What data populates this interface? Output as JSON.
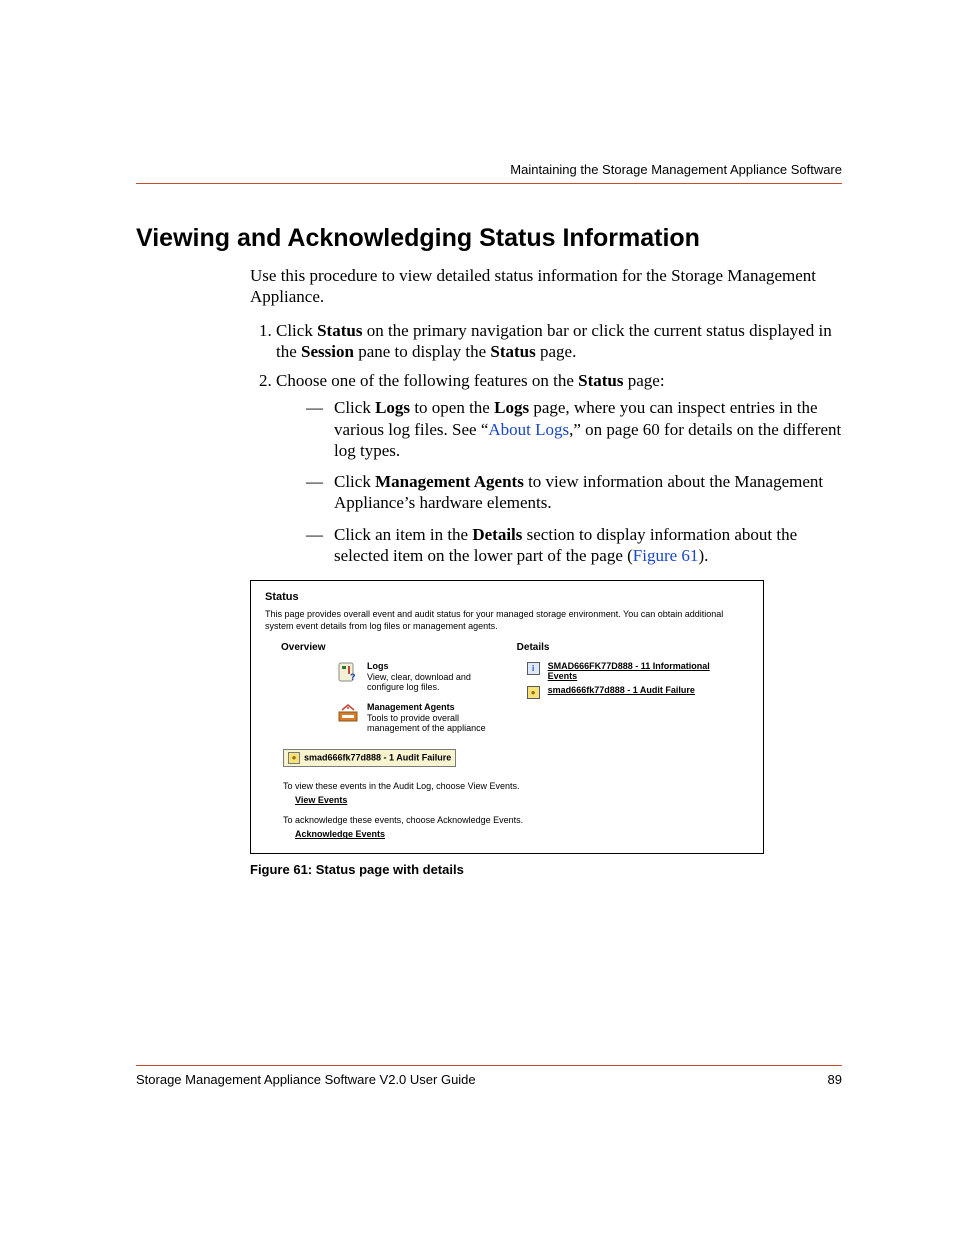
{
  "header": {
    "running_title": "Maintaining the Storage Management Appliance Software"
  },
  "title": "Viewing and Acknowledging Status Information",
  "intro": "Use this procedure to view detailed status information for the Storage Management Appliance.",
  "steps": {
    "s1_a": "Click ",
    "s1_b": "Status",
    "s1_c": " on the primary navigation bar or click the current status displayed in the ",
    "s1_d": "Session",
    "s1_e": " pane to display the ",
    "s1_f": "Status",
    "s1_g": " page.",
    "s2_a": "Choose one of the following features on the ",
    "s2_b": "Status",
    "s2_c": " page:",
    "b1_a": "Click ",
    "b1_b": "Logs",
    "b1_c": " to open the ",
    "b1_d": "Logs",
    "b1_e": " page, where you can inspect entries in the various log files. See “",
    "b1_link": "About Logs",
    "b1_f": ",” on page 60 for details on the different log types.",
    "b2_a": "Click ",
    "b2_b": "Management Agents",
    "b2_c": " to view information about the Management Appliance’s hardware elements.",
    "b3_a": "Click an item in the ",
    "b3_b": "Details",
    "b3_c": " section to display information about the selected item on the lower part of the page (",
    "b3_link": "Figure 61",
    "b3_d": ")."
  },
  "figure": {
    "title": "Status",
    "description": "This page provides overall event and audit status for your managed storage environment. You can obtain additional system event details from log files or management agents.",
    "overview_label": "Overview",
    "details_label": "Details",
    "logs_label": "Logs",
    "logs_desc": "View, clear, download and configure log files.",
    "agents_label": "Management Agents",
    "agents_desc": "Tools to provide overall management of the appliance",
    "detail1": "SMAD666FK77D888 - 11 Informational Events",
    "detail2": "smad666fk77d888 - 1 Audit Failure",
    "selected": "smad666fk77d888 - 1 Audit Failure",
    "view_line": "To view these events in the Audit Log, choose View Events.",
    "view_link": "View Events",
    "ack_line": "To acknowledge these events, choose Acknowledge Events.",
    "ack_link": "Acknowledge Events",
    "caption": "Figure 61:  Status page with details"
  },
  "footer": {
    "doc_title": "Storage Management Appliance Software V2.0 User Guide",
    "page_number": "89"
  }
}
